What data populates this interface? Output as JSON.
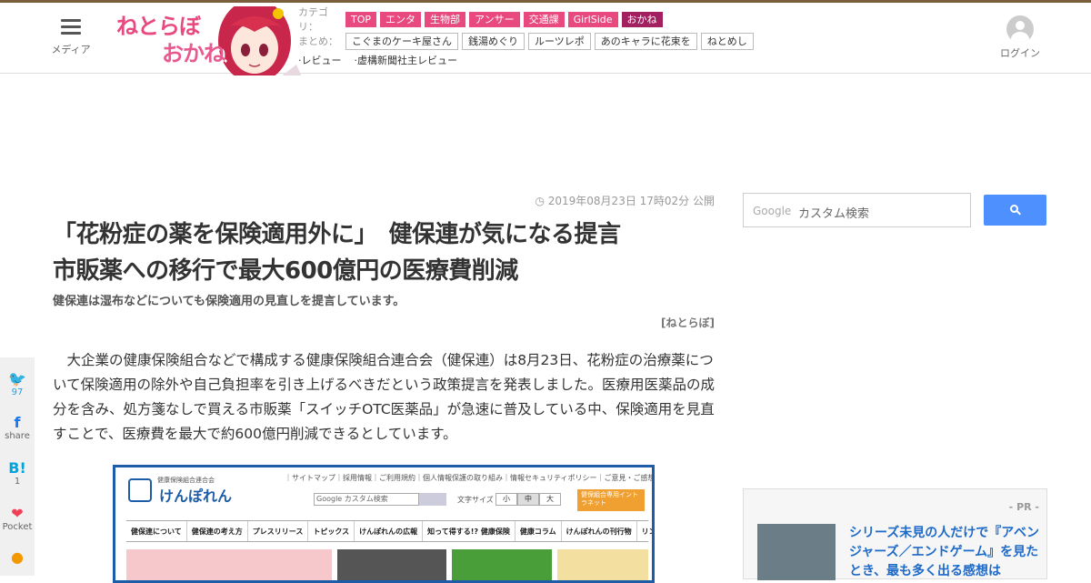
{
  "header": {
    "menu_label": "メディア",
    "logo_text_1": "ねとらぼ",
    "logo_text_2": "おかね",
    "category_label": "カテゴリ：",
    "categories": [
      "TOP",
      "エンタ",
      "生物部",
      "アンサー",
      "交通課",
      "GirlSide",
      "おかね"
    ],
    "active_category": "おかね",
    "matome_label": "まとめ：",
    "matome": [
      "こぐまのケーキ屋さん",
      "銭湯めぐり",
      "ルーツレポ",
      "あのキャラに花束を",
      "ねとめし"
    ],
    "reviews": [
      "·レビュー",
      "·虚構新聞社主レビュー"
    ],
    "login_label": "ログイン",
    "brand_color": "#e84a7f"
  },
  "article": {
    "date": "2019年08月23日 17時02分 公開",
    "title_line1": "「花粉症の薬を保険適用外に」　健保連が気になる提言",
    "title_line2": "市販薬への移行で最大600億円の医療費削減",
    "subtitle": "健保連は湿布などについても保険適用の見直しを提言しています。",
    "source": "[ねとらぼ]",
    "body": "大企業の健康保険組合などで構成する健康保険組合連合会（健保連）は8月23日、花粉症の治療薬について保険適用の除外や自己負担率を引き上げるべきだという政策提言を発表しました。医療用医薬品の成分を含み、処方箋なしで買える市販薬「スイッチOTC医薬品」が急速に普及している中、保険適用を見直すことで、医療費を最大で約600億円削減できるとしています。"
  },
  "embedded_screenshot": {
    "org_small": "健康保険組合連合会",
    "org_name": "けんぽれん",
    "top_links": "｜サイトマップ｜採用情報｜ご利用規約｜個人情報保護の取り組み｜情報セキュリティポリシー｜ご意見・ご感想",
    "search_placeholder": "Google カスタム検索",
    "font_size_label": "文字サイズ",
    "font_sizes": [
      "小",
      "中",
      "大"
    ],
    "orange_button": "健保組合専用イントラネット",
    "nav": [
      "健保連について",
      "健保連の考え方",
      "プレスリリース",
      "トピックス",
      "けんぽれんの広報",
      "知って得する!? 健康保険",
      "健康コラム",
      "けんぽれんの刊行物",
      "リンク集"
    ]
  },
  "share": [
    {
      "icon": "twitter-icon",
      "glyph": "🐦",
      "count": "97"
    },
    {
      "icon": "facebook-icon",
      "glyph": "f",
      "count": "share"
    },
    {
      "icon": "hatena-icon",
      "glyph": "B!",
      "count": "1"
    },
    {
      "icon": "pocket-icon",
      "glyph": "❤",
      "count": "Pocket"
    },
    {
      "icon": "line-icon",
      "glyph": "●",
      "count": ""
    }
  ],
  "sidebar": {
    "search_brand": "Google",
    "search_placeholder": "カスタム検索",
    "pr_label": "- PR -",
    "pr_title": "シリーズ未見の人だけで『アベンジャーズ／エンドゲーム』を見たとき、最も多く出る感想は"
  }
}
